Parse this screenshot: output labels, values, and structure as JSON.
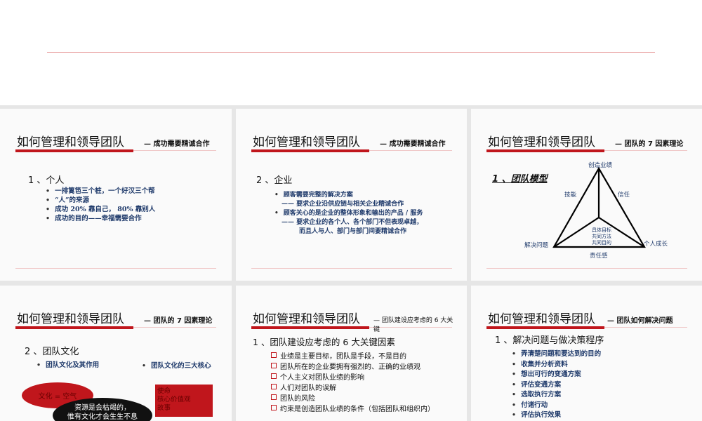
{
  "slides": [
    {
      "title": "如何管理和领导团队",
      "subtitle": "— 成功需要精诚合作",
      "heading": "1 、个人",
      "bullets": [
        "一排篱笆三个桩，一个好汉三个帮",
        "“人”的来源",
        "成功 20% 靠自己， 80% 靠别人",
        "成功的目的——幸福需要合作"
      ]
    },
    {
      "title": "如何管理和领导团队",
      "subtitle": "— 成功需要精诚合作",
      "heading": "2 、企业",
      "bullets": [
        "顾客需要完整的解决方案",
        "—— 要求企业沿供应链与相关企业精诚合作",
        "顾客关心的是企业的整体形象和输出的产品 / 服务",
        "—— 要求企业的各个人、各个部门不但表现卓越，",
        "而且人与人、部门与部门间要精诚合作"
      ]
    },
    {
      "title": "如何管理和领导团队",
      "subtitle": "— 团队的 7 因素理论",
      "heading": "1 、团队模型",
      "model": {
        "top": "创造业绩",
        "left_edge": "技能",
        "right_edge": "信任",
        "bottom_left": "解决问题",
        "bottom_right": "个人成长",
        "bottom_edge": "责任感",
        "center": [
          "具体目标",
          "共同方法",
          "共同目的"
        ]
      }
    },
    {
      "title": "如何管理和领导团队",
      "subtitle": "— 团队的 7 因素理论",
      "heading": "2 、团队文化",
      "bullets": [
        "团队文化及其作用",
        "团队文化的三大核心"
      ],
      "red_ellipse": "文化 = 空气",
      "black_ellipse": [
        "资源是会枯竭的，",
        "惟有文化才会生生不息"
      ],
      "red_box": [
        "使命",
        "核心价值观",
        "故事"
      ]
    },
    {
      "title": "如何管理和领导团队",
      "subtitle": "— 团队建设应考虑的 6 大关键",
      "heading": "1 、团队建设应考虑的 6 大关键因素",
      "bullets": [
        "业绩是主要目标，团队是手段，不是目的",
        "团队所在的企业要拥有强烈的、正确的业绩观",
        "个人主义对团队业绩的影响",
        "人们对团队的误解",
        "团队的风险",
        "约束是创造团队业绩的条件（包括团队和组织内）"
      ]
    },
    {
      "title": "如何管理和领导团队",
      "subtitle": "— 团队如何解决问题",
      "heading": "1 、解决问题与做决策程序",
      "bullets": [
        "弄清楚问题和要达到的目的",
        "收集并分析资料",
        "想出可行的变通方案",
        "评估变通方案",
        "选取执行方案",
        "付诸行动",
        "评估执行效果"
      ]
    }
  ]
}
